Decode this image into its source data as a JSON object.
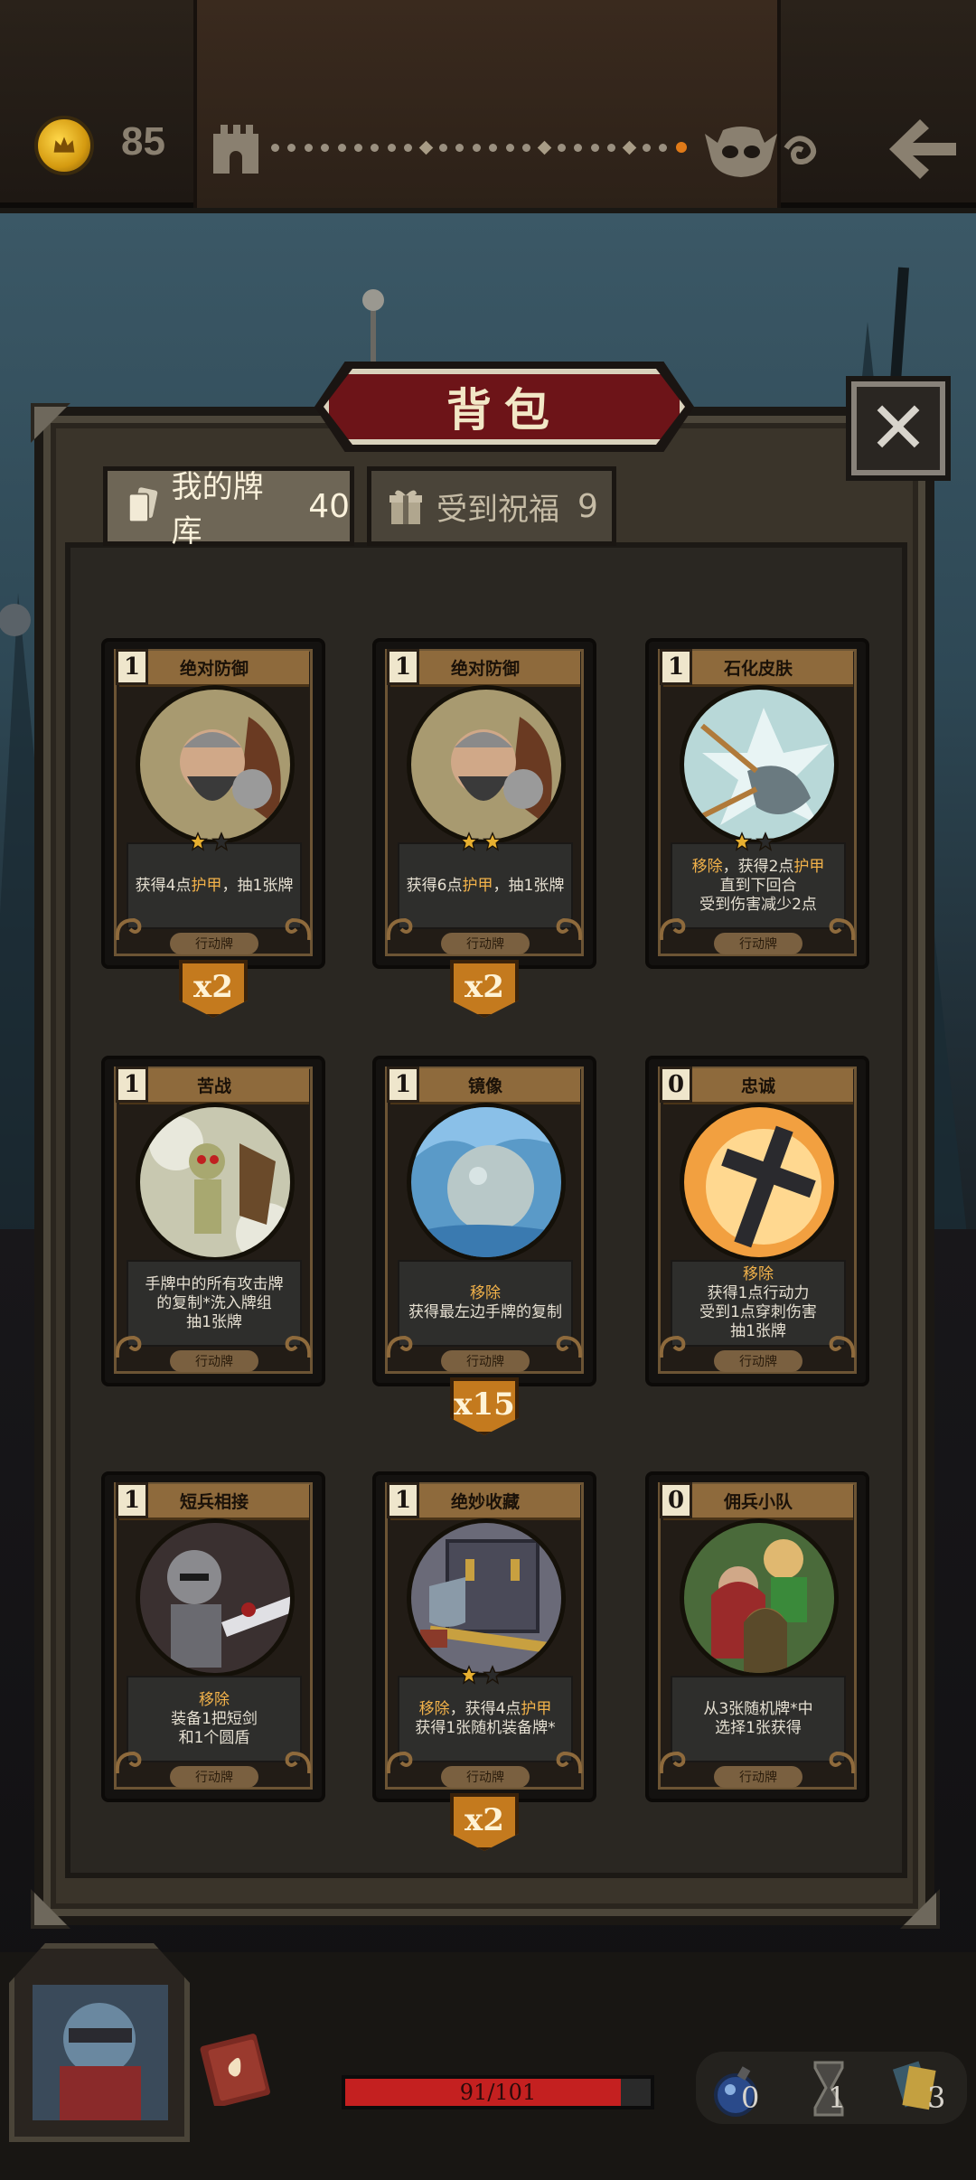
{
  "header": {
    "gold": "85",
    "path_nodes": [
      "dot",
      "dot",
      "dot",
      "dot",
      "dot",
      "dot",
      "dot",
      "dot",
      "dot",
      "diamond",
      "dot",
      "dot",
      "dot",
      "dot",
      "dot",
      "dot",
      "diamond",
      "dot",
      "dot",
      "dot",
      "dot",
      "diamond",
      "dot",
      "dot",
      "current"
    ]
  },
  "panel": {
    "title": "背包",
    "close_label": "✕",
    "tabs": [
      {
        "label": "我的牌库",
        "count": "40",
        "icon": "cards-icon"
      },
      {
        "label": "受到祝福",
        "count": "9",
        "icon": "gift-icon"
      }
    ]
  },
  "cards": [
    {
      "name": "绝对防御",
      "cost": "1",
      "art": "dwarf-shield",
      "stars": 1,
      "max_stars": 2,
      "lines": [
        [
          "获得4点",
          "护甲",
          "，抽1张牌"
        ]
      ],
      "type": "行动牌",
      "count": "x2"
    },
    {
      "name": "绝对防御",
      "cost": "1",
      "art": "dwarf-shield",
      "stars": 2,
      "max_stars": 2,
      "lines": [
        [
          "获得6点",
          "护甲",
          "，抽1张牌"
        ]
      ],
      "type": "行动牌",
      "count": "x2"
    },
    {
      "name": "石化皮肤",
      "cost": "1",
      "art": "stone-skin",
      "stars": 1,
      "max_stars": 2,
      "lines": [
        [
          "",
          "移除",
          "，获得2点",
          "护甲"
        ],
        [
          "直到下回合"
        ],
        [
          "受到伤害减少2点"
        ]
      ],
      "type": "行动牌",
      "count": ""
    },
    {
      "name": "苦战",
      "cost": "1",
      "art": "warrior-dust",
      "stars": 0,
      "max_stars": 0,
      "lines": [
        [
          "手牌中的所有攻击牌"
        ],
        [
          "的复制*洗入牌组"
        ],
        [
          "抽1张牌"
        ]
      ],
      "type": "行动牌",
      "count": ""
    },
    {
      "name": "镜像",
      "cost": "1",
      "art": "mirror-orb",
      "stars": 0,
      "max_stars": 0,
      "lines": [
        [
          "",
          "移除"
        ],
        [
          "获得最左边手牌的复制"
        ]
      ],
      "type": "行动牌",
      "count": "x15"
    },
    {
      "name": "忠诚",
      "cost": "0",
      "art": "holy-cross",
      "stars": 0,
      "max_stars": 0,
      "lines": [
        [
          "",
          "移除"
        ],
        [
          "获得1点行动力"
        ],
        [
          "受到1点穿刺伤害"
        ],
        [
          "抽1张牌"
        ]
      ],
      "type": "行动牌",
      "count": ""
    },
    {
      "name": "短兵相接",
      "cost": "1",
      "art": "knight-sword",
      "stars": 0,
      "max_stars": 0,
      "lines": [
        [
          "",
          "移除"
        ],
        [
          "装备1把短剑"
        ],
        [
          "和1个圆盾"
        ]
      ],
      "type": "行动牌",
      "count": ""
    },
    {
      "name": "绝妙收藏",
      "cost": "1",
      "art": "weapon-rack",
      "stars": 1,
      "max_stars": 2,
      "lines": [
        [
          "",
          "移除",
          "，获得4点",
          "护甲"
        ],
        [
          "获得1张随机装备牌*"
        ]
      ],
      "type": "行动牌",
      "count": "x2"
    },
    {
      "name": "佣兵小队",
      "cost": "0",
      "art": "mercenaries",
      "stars": 0,
      "max_stars": 0,
      "lines": [
        [
          "从3张随机牌*中"
        ],
        [
          "选择1张获得"
        ]
      ],
      "type": "行动牌",
      "count": ""
    }
  ],
  "footer": {
    "hp_text": "91/101",
    "hp_current": 91,
    "hp_max": 101,
    "resources": [
      {
        "icon": "potion-icon",
        "value": "0"
      },
      {
        "icon": "hourglass-icon",
        "value": "1"
      },
      {
        "icon": "card-stack-icon",
        "value": "3"
      }
    ]
  },
  "colors": {
    "accent_gold": "#c47a1e",
    "highlight_text": "#f2b24a",
    "title_red": "#6d1418",
    "hp_red": "#c42020"
  }
}
